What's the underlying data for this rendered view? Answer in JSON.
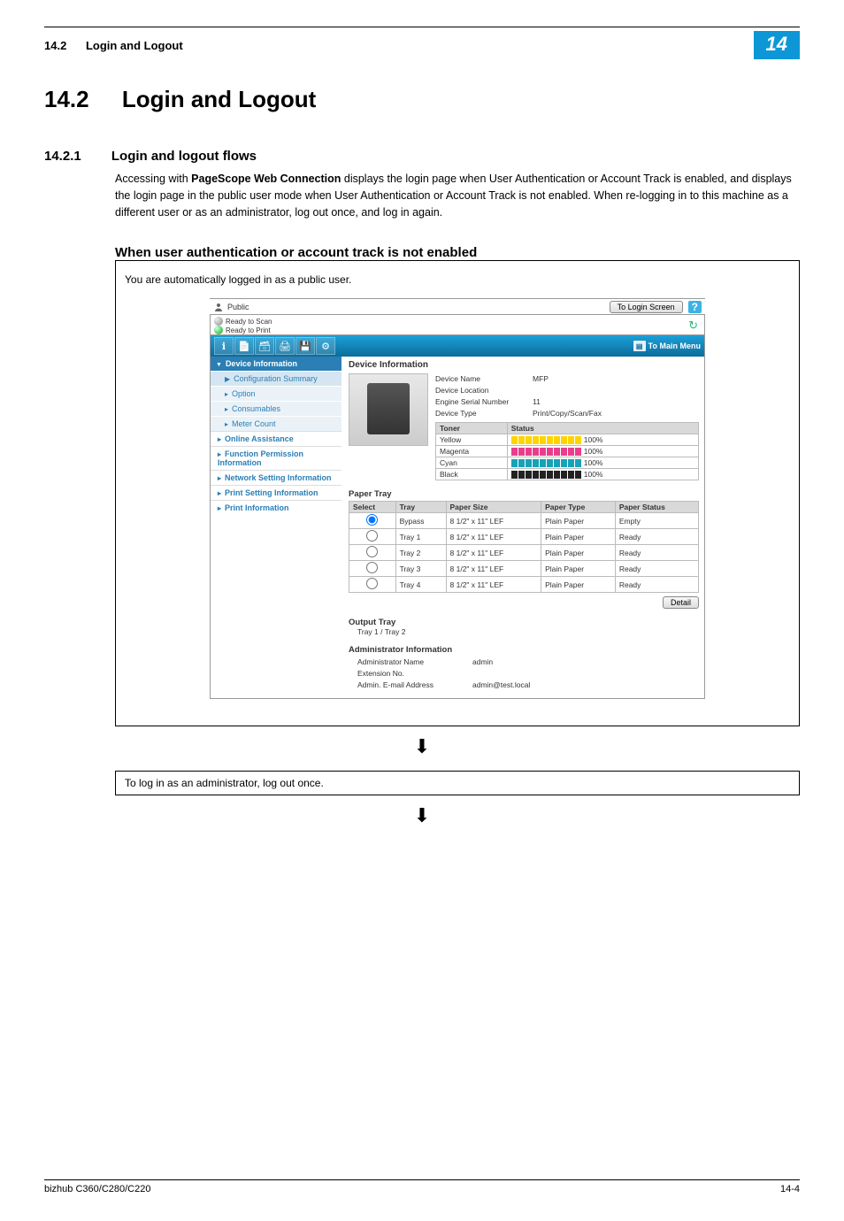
{
  "header": {
    "section_number": "14.2",
    "section_title": "Login and Logout",
    "chapter_badge": "14"
  },
  "h1": {
    "number": "14.2",
    "title": "Login and Logout"
  },
  "h2": {
    "number": "14.2.1",
    "title": "Login and logout flows"
  },
  "intro_text": "Accessing with PageScope Web Connection displays the login page when User Authentication or Account Track is enabled, and displays the login page in the public user mode when User Authentication or Account Track is not enabled. When re-logging in to this machine as a different user or as an administrator, log out once, and log in again.",
  "intro_bold": "PageScope Web Connection",
  "h3_text": "When user authentication or account track is not enabled",
  "caption1": "You are automatically logged in as a public user.",
  "caption2": "To log in as an administrator, log out once.",
  "wc": {
    "user_label": "Public",
    "login_button": "To Login Screen",
    "help": "?",
    "status": {
      "scan": "Ready to Scan",
      "print": "Ready to Print"
    },
    "to_main_menu": "To Main Menu",
    "sidebar": {
      "device_info": "Device Information",
      "config_summary": "Configuration Summary",
      "option": "Option",
      "consumables": "Consumables",
      "meter_count": "Meter Count",
      "online_assist": "Online Assistance",
      "func_perm": "Function Permission Information",
      "network": "Network Setting Information",
      "print_setting": "Print Setting Information",
      "print_info": "Print Information"
    },
    "main": {
      "title": "Device Information",
      "device_name_k": "Device Name",
      "device_name_v": "MFP",
      "device_loc_k": "Device Location",
      "device_loc_v": "",
      "serial_k": "Engine Serial Number",
      "serial_v": "11",
      "device_type_k": "Device Type",
      "device_type_v": "Print/Copy/Scan/Fax",
      "toner_h_toner": "Toner",
      "toner_h_status": "Status",
      "toner_rows": [
        {
          "name": "Yellow",
          "class": "y",
          "pct": "100%"
        },
        {
          "name": "Magenta",
          "class": "m",
          "pct": "100%"
        },
        {
          "name": "Cyan",
          "class": "c",
          "pct": "100%"
        },
        {
          "name": "Black",
          "class": "k",
          "pct": "100%"
        }
      ],
      "paper_tray_h": "Paper Tray",
      "paper_th": {
        "select": "Select",
        "tray": "Tray",
        "size": "Paper Size",
        "type": "Paper Type",
        "status": "Paper Status"
      },
      "paper_rows": [
        {
          "sel": true,
          "tray": "Bypass",
          "size": "8 1/2\" x 11\" LEF",
          "type": "Plain Paper",
          "status": "Empty"
        },
        {
          "sel": false,
          "tray": "Tray 1",
          "size": "8 1/2\" x 11\" LEF",
          "type": "Plain Paper",
          "status": "Ready"
        },
        {
          "sel": false,
          "tray": "Tray 2",
          "size": "8 1/2\" x 11\" LEF",
          "type": "Plain Paper",
          "status": "Ready"
        },
        {
          "sel": false,
          "tray": "Tray 3",
          "size": "8 1/2\" x 11\" LEF",
          "type": "Plain Paper",
          "status": "Ready"
        },
        {
          "sel": false,
          "tray": "Tray 4",
          "size": "8 1/2\" x 11\" LEF",
          "type": "Plain Paper",
          "status": "Ready"
        }
      ],
      "detail_btn": "Detail",
      "output_tray_h": "Output Tray",
      "output_tray_v": "Tray 1 / Tray 2",
      "admin_h": "Administrator Information",
      "admin_name_k": "Administrator Name",
      "admin_name_v": "admin",
      "ext_k": "Extension No.",
      "ext_v": "",
      "email_k": "Admin. E-mail Address",
      "email_v": "admin@test.local"
    }
  },
  "footer": {
    "left": "bizhub C360/C280/C220",
    "right": "14-4"
  }
}
